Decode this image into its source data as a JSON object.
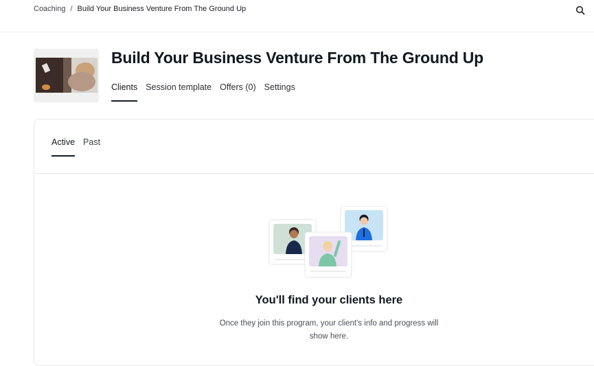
{
  "breadcrumb": {
    "parent": "Coaching",
    "separator": "/",
    "current": "Build Your Business Venture From The Ground Up"
  },
  "header": {
    "title": "Build Your Business Venture From The Ground Up",
    "tabs": [
      {
        "label": "Clients",
        "active": true
      },
      {
        "label": "Session template",
        "active": false
      },
      {
        "label": "Offers (0)",
        "active": false
      },
      {
        "label": "Settings",
        "active": false
      }
    ]
  },
  "clients": {
    "subtabs": [
      {
        "label": "Active",
        "active": true
      },
      {
        "label": "Past",
        "active": false
      }
    ],
    "empty_state": {
      "title": "You'll find your clients here",
      "description": "Once they join this program, your client's info and progress will show here."
    }
  },
  "icons": {
    "search": "search-icon"
  },
  "colors": {
    "text_primary": "#111820",
    "active_underline": "#161d25",
    "card_green": "#cfe0d6",
    "card_purple": "#e7ddf1",
    "card_blue": "#c9e3f6"
  }
}
